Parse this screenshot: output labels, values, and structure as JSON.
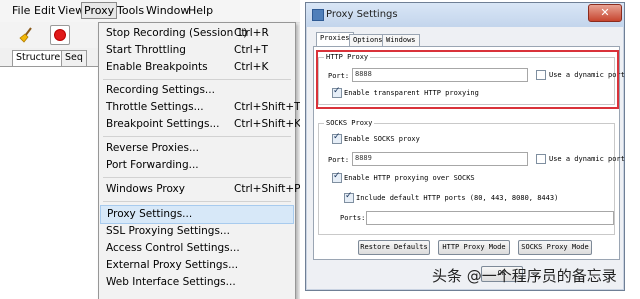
{
  "menubar": {
    "items": [
      "File",
      "Edit",
      "View",
      "Proxy",
      "Tools",
      "Window",
      "Help"
    ],
    "active": "Proxy"
  },
  "left_tabs": [
    "Structure",
    "Seq"
  ],
  "proxy_menu": {
    "items": [
      {
        "label": "Stop Recording (Session 1)",
        "shortcut": "Ctrl+R"
      },
      {
        "label": "Start Throttling",
        "shortcut": "Ctrl+T"
      },
      {
        "label": "Enable Breakpoints",
        "shortcut": "Ctrl+K"
      },
      {
        "label": "Recording Settings...",
        "shortcut": ""
      },
      {
        "label": "Throttle Settings...",
        "shortcut": "Ctrl+Shift+T"
      },
      {
        "label": "Breakpoint Settings...",
        "shortcut": "Ctrl+Shift+K"
      },
      {
        "label": "Reverse Proxies...",
        "shortcut": ""
      },
      {
        "label": "Port Forwarding...",
        "shortcut": ""
      },
      {
        "label": "Windows Proxy",
        "shortcut": "Ctrl+Shift+P"
      },
      {
        "label": "Proxy Settings...",
        "shortcut": ""
      },
      {
        "label": "SSL Proxying Settings...",
        "shortcut": ""
      },
      {
        "label": "Access Control Settings...",
        "shortcut": ""
      },
      {
        "label": "External Proxy Settings...",
        "shortcut": ""
      },
      {
        "label": "Web Interface Settings...",
        "shortcut": ""
      }
    ],
    "highlighted": "Proxy Settings..."
  },
  "dialog": {
    "title": "Proxy Settings",
    "close": "✕",
    "tabs": [
      "Proxies",
      "Options",
      "Windows"
    ],
    "http": {
      "group_title": "HTTP Proxy",
      "port_label": "Port:",
      "port_value": "8888",
      "dynamic_label": "Use a dynamic port",
      "transparent_label": "Enable transparent HTTP proxying"
    },
    "socks": {
      "group_title": "SOCKS Proxy",
      "enable_label": "Enable SOCKS proxy",
      "port_label": "Port:",
      "port_value": "8889",
      "dynamic_label": "Use a dynamic port",
      "http_over_socks_label": "Enable HTTP proxying over SOCKS",
      "default_ports_label": "Include default HTTP ports (80, 443, 8080, 8443)",
      "ports_label": "Ports:"
    },
    "buttons": [
      "Restore Defaults",
      "HTTP Proxy Mode",
      "SOCKS Proxy Mode"
    ],
    "ok_label": "OK"
  },
  "watermark": "头条 @一个程序员的备忘录",
  "colors": {
    "highlight_box": "#d9323a",
    "menu_hover": "#d7e8f8",
    "record": "#e01a1a"
  }
}
